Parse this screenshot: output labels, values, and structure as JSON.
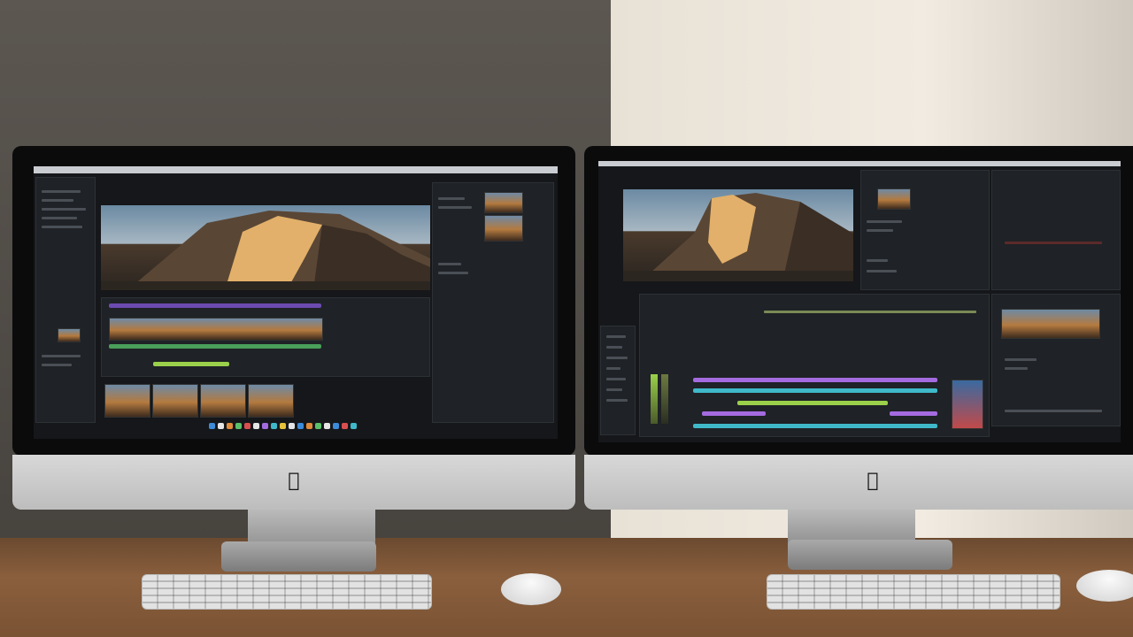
{
  "scene": {
    "description_colors": {
      "desk": "#8a5f3d",
      "wall_light": "#f1ebe1",
      "wall_dark": "#47433e",
      "ui_bg": "#15171a"
    }
  },
  "left_monitor": {
    "logo_icon": "apple-logo-icon"
  },
  "right_monitor": {
    "logo_icon": "apple-logo-icon",
    "timeline_colors": [
      "#a46be0",
      "#3fb9c9",
      "#9bd14a",
      "#a46be0",
      "#3fb9c9"
    ]
  }
}
